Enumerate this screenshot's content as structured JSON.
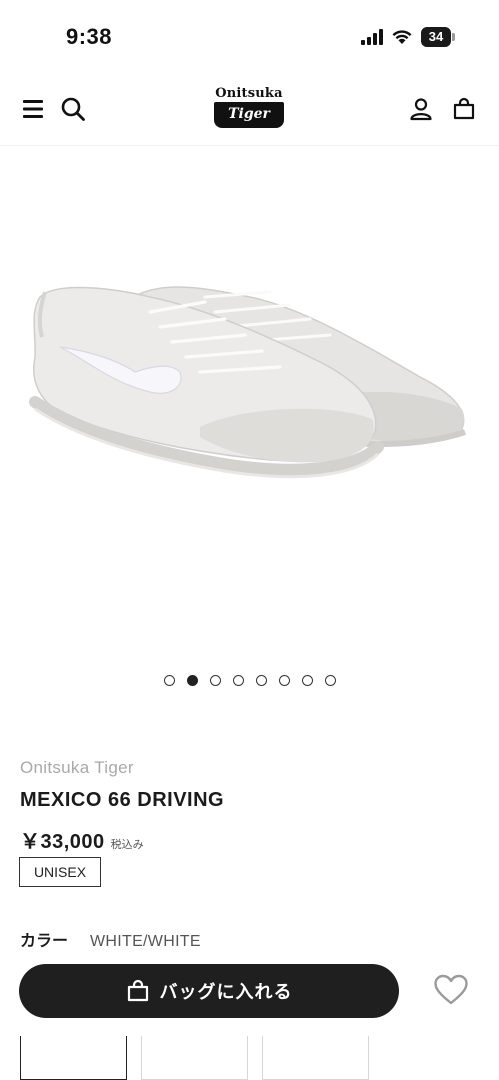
{
  "status_bar": {
    "time": "9:38",
    "battery": "34"
  },
  "header": {
    "logo_top": "Onitsuka",
    "logo_badge": "Tiger"
  },
  "product": {
    "image_alt": "Onitsuka Tiger MEXICO 66 DRIVING white sneakers",
    "carousel": {
      "total": 8,
      "active_index": 1
    },
    "brand": "Onitsuka Tiger",
    "name": "MEXICO 66 DRIVING",
    "price": "￥33,000",
    "tax_note": "税込み",
    "gender": "UNISEX",
    "color_label": "カラー",
    "color_value": "WHITE/WHITE",
    "add_to_bag_label": "バッグに入れる"
  },
  "colors": {
    "primary": "#1f1f1f",
    "brand_gray": "#a9a9a9",
    "background": "#ffffff"
  },
  "icons": [
    "menu-icon",
    "search-icon",
    "account-icon",
    "bag-icon",
    "heart-icon"
  ]
}
